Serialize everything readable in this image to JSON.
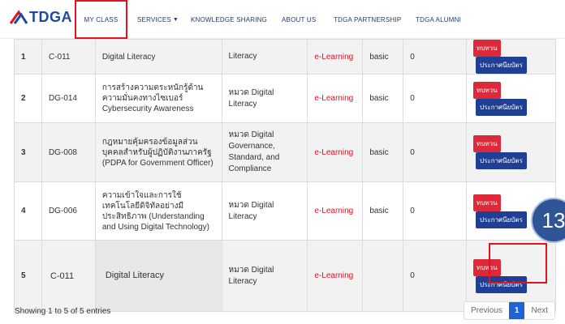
{
  "nav": {
    "logo_text": "TDGA",
    "items": [
      {
        "label": "MY CLASS",
        "active": true
      },
      {
        "label": "SERVICES",
        "dropdown": true
      },
      {
        "label": "KNOWLEDGE SHARING"
      },
      {
        "label": "ABOUT US"
      },
      {
        "label": "TDGA PARTNERSHIP"
      },
      {
        "label": "TDGA ALUMNI"
      }
    ]
  },
  "table": {
    "rows": [
      {
        "no": "1",
        "code": "C-011",
        "name": "Digital Literacy",
        "category": "Literacy",
        "type": "e-Learning",
        "level": "basic",
        "count": "0"
      },
      {
        "no": "2",
        "code": "DG-014",
        "name": "การสร้างความตระหนักรู้ด้านความมั่นคงทางไซเบอร์ Cybersecurity Awareness",
        "category": "หมวด Digital Literacy",
        "type": "e-Learning",
        "level": "basic",
        "count": "0"
      },
      {
        "no": "3",
        "code": "DG-008",
        "name": "กฎหมายคุ้มครองข้อมูลส่วนบุคคลสำหรับผู้ปฏิบัติงานภาครัฐ (PDPA for Government Officer)",
        "category": "หมวด Digital Governance, Standard, and Compliance",
        "type": "e-Learning",
        "level": "basic",
        "count": "0"
      },
      {
        "no": "4",
        "code": "DG-006",
        "name": "ความเข้าใจและการใช้เทคโนโลยีดิจิทัลอย่างมีประสิทธิภาพ (Understanding and Using Digital Technology)",
        "category": "หมวด Digital Literacy",
        "type": "e-Learning",
        "level": "basic",
        "count": "0"
      },
      {
        "no": "5",
        "code": "C-011",
        "name": "Digital Literacy",
        "category": "หมวด Digital Literacy",
        "type": "e-Learning",
        "level": "",
        "count": "0"
      }
    ],
    "btn_review": "ทบทวน",
    "btn_cert": "ประกาศนียบัตร"
  },
  "annotation": {
    "step": "13"
  },
  "footer": {
    "info": "Showing 1 to 5 of 5 entries",
    "prev": "Previous",
    "page": "1",
    "next": "Next"
  },
  "colors": {
    "brand_blue": "#1f3f95",
    "red": "#dc2a3a",
    "active_page": "#1f63d6",
    "badge": "#2f5597"
  }
}
